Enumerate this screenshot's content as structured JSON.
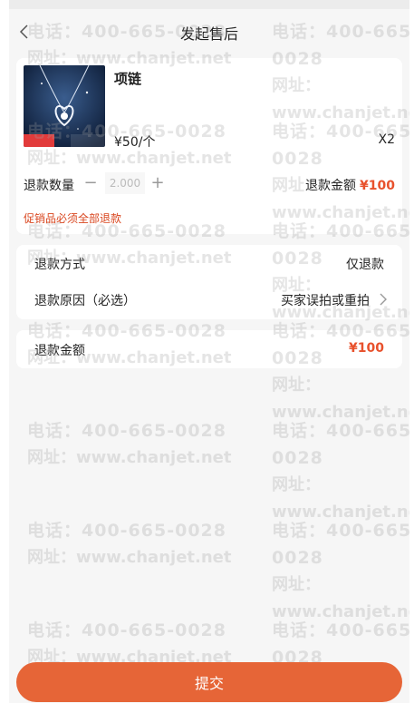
{
  "nav": {
    "title": "发起售后",
    "back_icon": "chevron-left-icon"
  },
  "product": {
    "name": "项链",
    "price": "¥50/个",
    "quantity": "X2",
    "image_icon": "necklace-product-image"
  },
  "refund": {
    "qty_label": "退款数量",
    "qty_value": "2.000",
    "minus": "−",
    "plus": "+",
    "amount_label": "退款金额",
    "amount_value": "¥100",
    "promo_note": "促销品必须全部退款"
  },
  "method": {
    "method_label": "退款方式",
    "method_value": "仅退款",
    "reason_label": "退款原因（必选）",
    "reason_value": "买家误拍或重拍"
  },
  "total": {
    "label": "退款金额",
    "value": "¥100"
  },
  "submit_label": "提交",
  "watermark": {
    "line1": "电话：400-665-0028",
    "line2": "网址：www.chanjet.net"
  },
  "colors": {
    "accent": "#e66537",
    "price_red": "#e8512c",
    "note_red": "#d9461f"
  }
}
